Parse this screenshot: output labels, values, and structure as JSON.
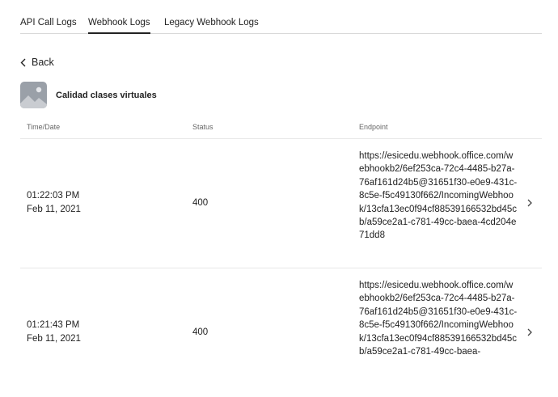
{
  "tabs": [
    {
      "label": "API Call Logs"
    },
    {
      "label": "Webhook Logs"
    },
    {
      "label": "Legacy Webhook Logs"
    }
  ],
  "back": {
    "label": "Back",
    "icon": "chevron-left-icon"
  },
  "app": {
    "name": "Calidad clases virtuales",
    "icon": "image-placeholder-icon"
  },
  "table": {
    "headers": {
      "time": "Time/Date",
      "status": "Status",
      "endpoint": "Endpoint"
    },
    "rows": [
      {
        "time": "01:22:03 PM",
        "date": "Feb 11, 2021",
        "status": "400",
        "endpoint": "https://esicedu.webhook.office.com/webhookb2/6ef253ca-72c4-4485-b27a-76af161d24b5@31651f30-e0e9-431c-8c5e-f5c49130f662/IncomingWebhook/13cfa13ec0f94cf88539166532bd45cb/a59ce2a1-c781-49cc-baea-4cd204e71dd8"
      },
      {
        "time": "01:21:43 PM",
        "date": "Feb 11, 2021",
        "status": "400",
        "endpoint": "https://esicedu.webhook.office.com/webhookb2/6ef253ca-72c4-4485-b27a-76af161d24b5@31651f30-e0e9-431c-8c5e-f5c49130f662/IncomingWebhook/13cfa13ec0f94cf88539166532bd45cb/a59ce2a1-c781-49cc-baea-"
      }
    ]
  },
  "colors": {
    "text": "#222222",
    "muted": "#666666",
    "divider": "#e8e8e8",
    "thumb": "#9aa0a8"
  }
}
